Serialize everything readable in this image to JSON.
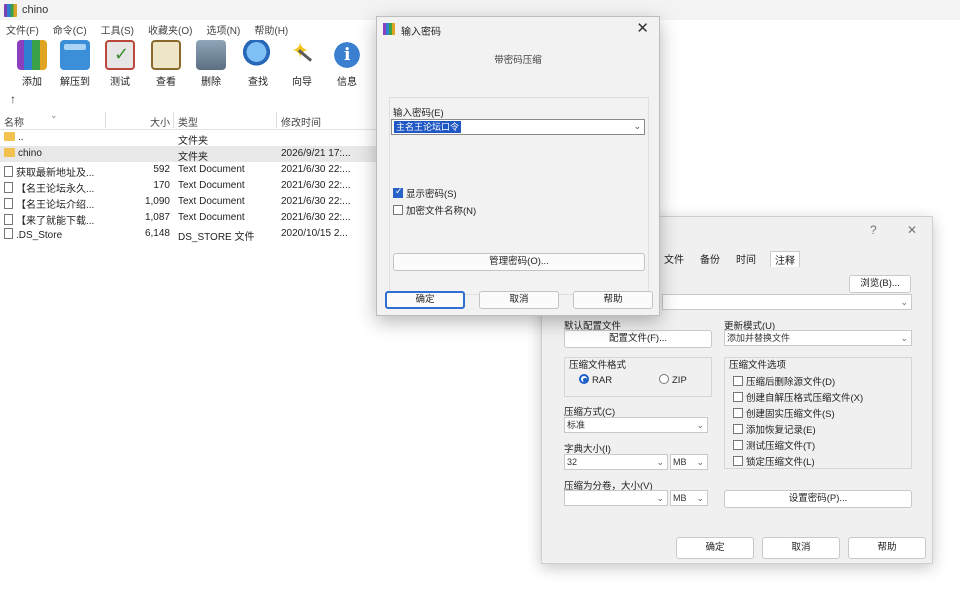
{
  "window": {
    "title": "chino"
  },
  "menu": [
    "文件(F)",
    "命令(C)",
    "工具(S)",
    "收藏夹(O)",
    "选项(N)",
    "帮助(H)"
  ],
  "toolbar": [
    {
      "label": "添加",
      "icon": "add-archive-icon"
    },
    {
      "label": "解压到",
      "icon": "extract-folder-icon"
    },
    {
      "label": "测试",
      "icon": "test-check-icon"
    },
    {
      "label": "查看",
      "icon": "view-book-icon"
    },
    {
      "label": "删除",
      "icon": "trash-icon"
    },
    {
      "label": "查找",
      "icon": "magnifier-icon"
    },
    {
      "label": "向导",
      "icon": "magic-wand-icon"
    },
    {
      "label": "信息",
      "icon": "info-icon"
    }
  ],
  "filelist": {
    "headers": {
      "name": "名称",
      "size": "大小",
      "type": "类型",
      "modified": "修改时间"
    },
    "rows": [
      {
        "name": "..",
        "size": "",
        "type": "文件夹",
        "modified": "",
        "kind": "up"
      },
      {
        "name": "chino",
        "size": "",
        "type": "文件夹",
        "modified": "2026/9/21 17:...",
        "kind": "folder"
      },
      {
        "name": "获取最新地址及...",
        "size": "592",
        "type": "Text Document",
        "modified": "2021/6/30 22:...",
        "kind": "doc"
      },
      {
        "name": "【名王论坛永久...",
        "size": "170",
        "type": "Text Document",
        "modified": "2021/6/30 22:...",
        "kind": "doc"
      },
      {
        "name": "【名王论坛介绍...",
        "size": "1,090",
        "type": "Text Document",
        "modified": "2021/6/30 22:...",
        "kind": "doc"
      },
      {
        "name": "【来了就能下载...",
        "size": "1,087",
        "type": "Text Document",
        "modified": "2021/6/30 22:...",
        "kind": "doc"
      },
      {
        "name": ".DS_Store",
        "size": "6,148",
        "type": "DS_STORE 文件",
        "modified": "2020/10/15 2...",
        "kind": "doc"
      }
    ]
  },
  "settings_dialog": {
    "help_glyph": "?",
    "close_glyph": "✕",
    "tabs": [
      "文件",
      "备份",
      "时间",
      "注释"
    ],
    "browse_button": "浏览(B)...",
    "default_config_label": "默认配置文件",
    "config_button": "配置文件(F)...",
    "update_mode_label": "更新模式(U)",
    "update_mode_value": "添加并替换文件",
    "format_group": "压缩文件格式",
    "format_rar": "RAR",
    "format_zip": "ZIP",
    "method_label": "压缩方式(C)",
    "method_value": "标准",
    "dict_label": "字典大小(I)",
    "dict_value": "32",
    "dict_unit": "MB",
    "split_label": "压缩为分卷，大小(V)",
    "split_unit": "MB",
    "options_group": "压缩文件选项",
    "options": [
      "压缩后删除源文件(D)",
      "创建自解压格式压缩文件(X)",
      "创建固实压缩文件(S)",
      "添加恢复记录(E)",
      "测试压缩文件(T)",
      "锁定压缩文件(L)"
    ],
    "set_password_button": "设置密码(P)...",
    "ok": "确定",
    "cancel": "取消",
    "help": "帮助"
  },
  "password_dialog": {
    "title": "输入密码",
    "close_glyph": "✕",
    "subtitle": "带密码压缩",
    "input_label": "输入密码(E)",
    "input_value": "主名王论坛口令",
    "show_password": "显示密码(S)",
    "encrypt_filenames": "加密文件名称(N)",
    "manage_button": "管理密码(O)...",
    "ok": "确定",
    "cancel": "取消",
    "help": "帮助"
  }
}
